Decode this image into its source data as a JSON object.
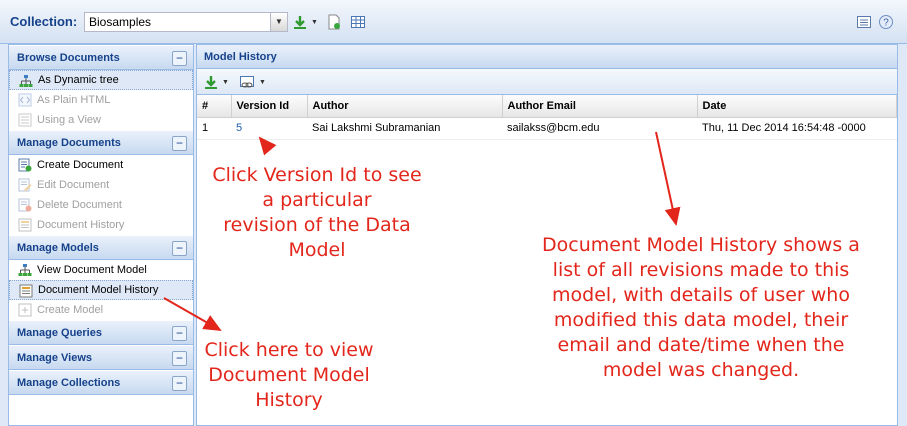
{
  "topbar": {
    "collection_label": "Collection:",
    "collection_value": "Biosamples",
    "icons": [
      "download-icon",
      "new-document-icon",
      "grid-view-icon",
      "list-view-icon",
      "help-icon"
    ]
  },
  "sidebar": {
    "sections": [
      {
        "title": "Browse Documents",
        "toggle": "−",
        "items": [
          {
            "label": "As Dynamic tree",
            "icon": "tree-icon",
            "state": "selected"
          },
          {
            "label": "As Plain HTML",
            "icon": "html-icon",
            "state": "disabled"
          },
          {
            "label": "Using a View",
            "icon": "view-icon",
            "state": "disabled"
          }
        ]
      },
      {
        "title": "Manage Documents",
        "toggle": "−",
        "items": [
          {
            "label": "Create Document",
            "icon": "create-document-icon",
            "state": "normal"
          },
          {
            "label": "Edit Document",
            "icon": "edit-document-icon",
            "state": "disabled"
          },
          {
            "label": "Delete Document",
            "icon": "delete-document-icon",
            "state": "disabled"
          },
          {
            "label": "Document History",
            "icon": "document-history-icon",
            "state": "disabled"
          }
        ]
      },
      {
        "title": "Manage Models",
        "toggle": "−",
        "items": [
          {
            "label": "View Document Model",
            "icon": "tree-icon",
            "state": "normal"
          },
          {
            "label": "Document Model History",
            "icon": "document-history-icon",
            "state": "selected"
          },
          {
            "label": "Create Model",
            "icon": "create-model-icon",
            "state": "disabled"
          }
        ]
      },
      {
        "title": "Manage Queries",
        "toggle": "−",
        "items": []
      },
      {
        "title": "Manage Views",
        "toggle": "−",
        "items": []
      },
      {
        "title": "Manage Collections",
        "toggle": "−",
        "items": []
      }
    ]
  },
  "main": {
    "title": "Model History",
    "columns": [
      "#",
      "Version Id",
      "Author",
      "Author Email",
      "Date"
    ],
    "rows": [
      {
        "num": "1",
        "version": "5",
        "author": "Sai Lakshmi Subramanian",
        "email": "sailakss@bcm.edu",
        "date": "Thu, 11 Dec 2014 16:54:48 -0000"
      }
    ]
  },
  "annotations": {
    "version_note": [
      "Click Version Id to see",
      "a particular",
      "revision of the Data",
      "Model"
    ],
    "history_note": [
      "Document Model History shows a",
      "list of all revisions made to this",
      "model, with details of user who",
      "modified this data model, their",
      "email and date/time when the",
      "model was changed."
    ],
    "sidebar_note": [
      "Click here to view",
      "Document Model",
      "History"
    ]
  },
  "colors": {
    "accent": "#15428b",
    "annotation": "#e3261b",
    "link": "#1e5fa8",
    "border": "#99bbe8"
  }
}
